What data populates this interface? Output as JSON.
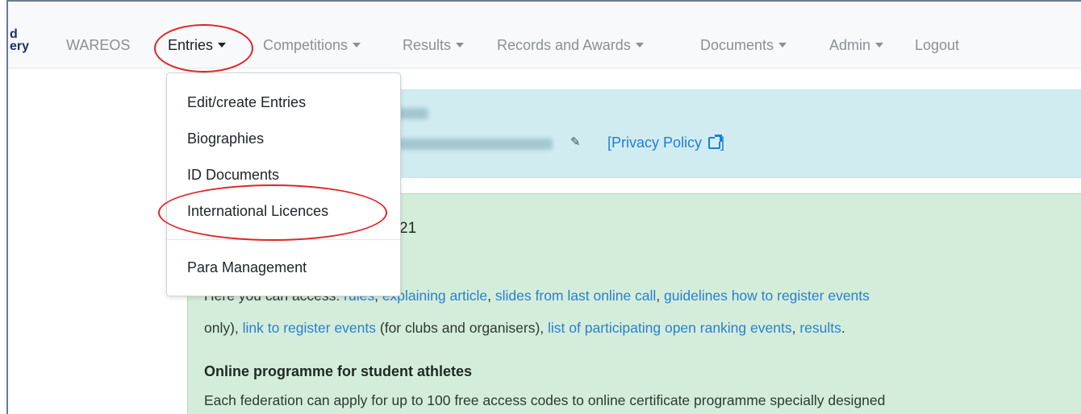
{
  "logo": {
    "line1": "d",
    "line2": "ery"
  },
  "nav": {
    "brand": "WAREOS",
    "items": [
      {
        "label": "Entries",
        "dropdown": true,
        "active": true
      },
      {
        "label": "Competitions",
        "dropdown": true
      },
      {
        "label": "Results",
        "dropdown": true
      },
      {
        "label": "Records and Awards",
        "dropdown": true
      },
      {
        "label": "Documents",
        "dropdown": true
      },
      {
        "label": "Admin",
        "dropdown": true
      },
      {
        "label": "Logout",
        "dropdown": false
      }
    ]
  },
  "dropdown": {
    "items": [
      "Edit/create Entries",
      "Biographies",
      "ID Documents",
      "International Licences"
    ],
    "after_divider": "Para Management"
  },
  "account": {
    "privacy_link": "[Privacy Policy",
    "privacy_close": "]"
  },
  "news": {
    "heading_fragment": "21",
    "line1_prefix": "Here you can access: ",
    "links1": [
      "rules",
      "explaining article",
      "slides from last online call",
      "guidelines how to register events"
    ],
    "line2_prefix": "only), ",
    "link_register": "link to register events",
    "line2_mid": " (for clubs and organisers), ",
    "link_list": "list of participating open ranking events",
    "link_results": "results",
    "subheading": "Online programme for student athletes",
    "line3": "Each federation can apply for up to 100 free access codes to online certificate programme specially designed"
  },
  "colors": {
    "highlight": "#e02424",
    "link": "#2a7fd0",
    "info_bg": "#d1ecf1",
    "success_bg": "#d4edda"
  }
}
